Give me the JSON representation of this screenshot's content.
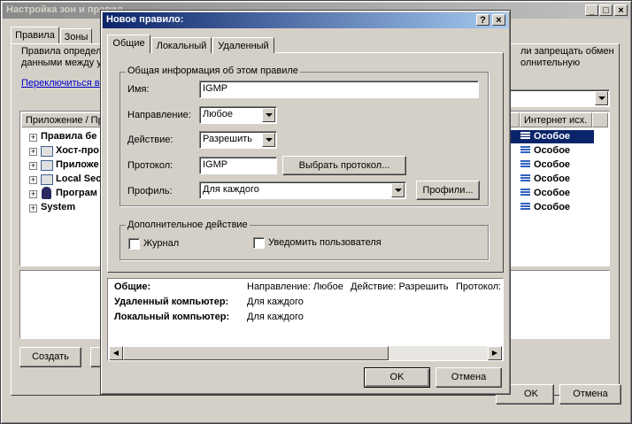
{
  "bg_window": {
    "title": "Настройка зон и правил",
    "tabs": [
      "Правила",
      "Зоны"
    ],
    "description_line1": "Правила определ",
    "description_line2": "данными между у",
    "description_right1": "ли запрещать обмен",
    "description_right2": "олнительную",
    "switch_link": "Переключиться в",
    "col_app": "Приложение / Пр",
    "col_internet": "Интернет исх.",
    "tree": [
      {
        "label": "Правила бе",
        "selected": true
      },
      {
        "label": "Хост-про",
        "selected": false
      },
      {
        "label": "Приложе",
        "selected": false
      },
      {
        "label": "Local Sec",
        "selected": false
      },
      {
        "label": "Програм",
        "selected": false
      },
      {
        "label": "System",
        "selected": false
      }
    ],
    "internet_values": [
      "Особое",
      "Особое",
      "Особое",
      "Особое",
      "Особое",
      "Особое"
    ],
    "create_button": "Создать",
    "ok_button": "OK",
    "cancel_button": "Отмена"
  },
  "dialog": {
    "title": "Новое правило:",
    "help_btn": "?",
    "close_btn": "×",
    "tabs": [
      "Общие",
      "Локальный",
      "Удаленный"
    ],
    "group_general": "Общая информация об этом правиле",
    "name_label": "Имя:",
    "name_value": "IGMP",
    "direction_label": "Направление:",
    "direction_value": "Любое",
    "action_label": "Действие:",
    "action_value": "Разрешить",
    "protocol_label": "Протокол:",
    "protocol_value": "IGMP",
    "select_protocol_button": "Выбрать протокол...",
    "profile_label": "Профиль:",
    "profile_value": "Для каждого",
    "profiles_button": "Профили...",
    "group_additional": "Дополнительное действие",
    "log_label": "Журнал",
    "notify_label": "Уведомить пользователя",
    "summary": {
      "general_label": "Общие:",
      "general_direction": "Направление: Любое",
      "general_action": "Действие: Разрешить",
      "general_protocol": "Протокол:",
      "remote_label": "Удаленный компьютер:",
      "remote_value": "Для каждого",
      "local_label": "Локальный компьютер:",
      "local_value": "Для каждого"
    },
    "ok_button": "OK",
    "cancel_button": "Отмена"
  }
}
